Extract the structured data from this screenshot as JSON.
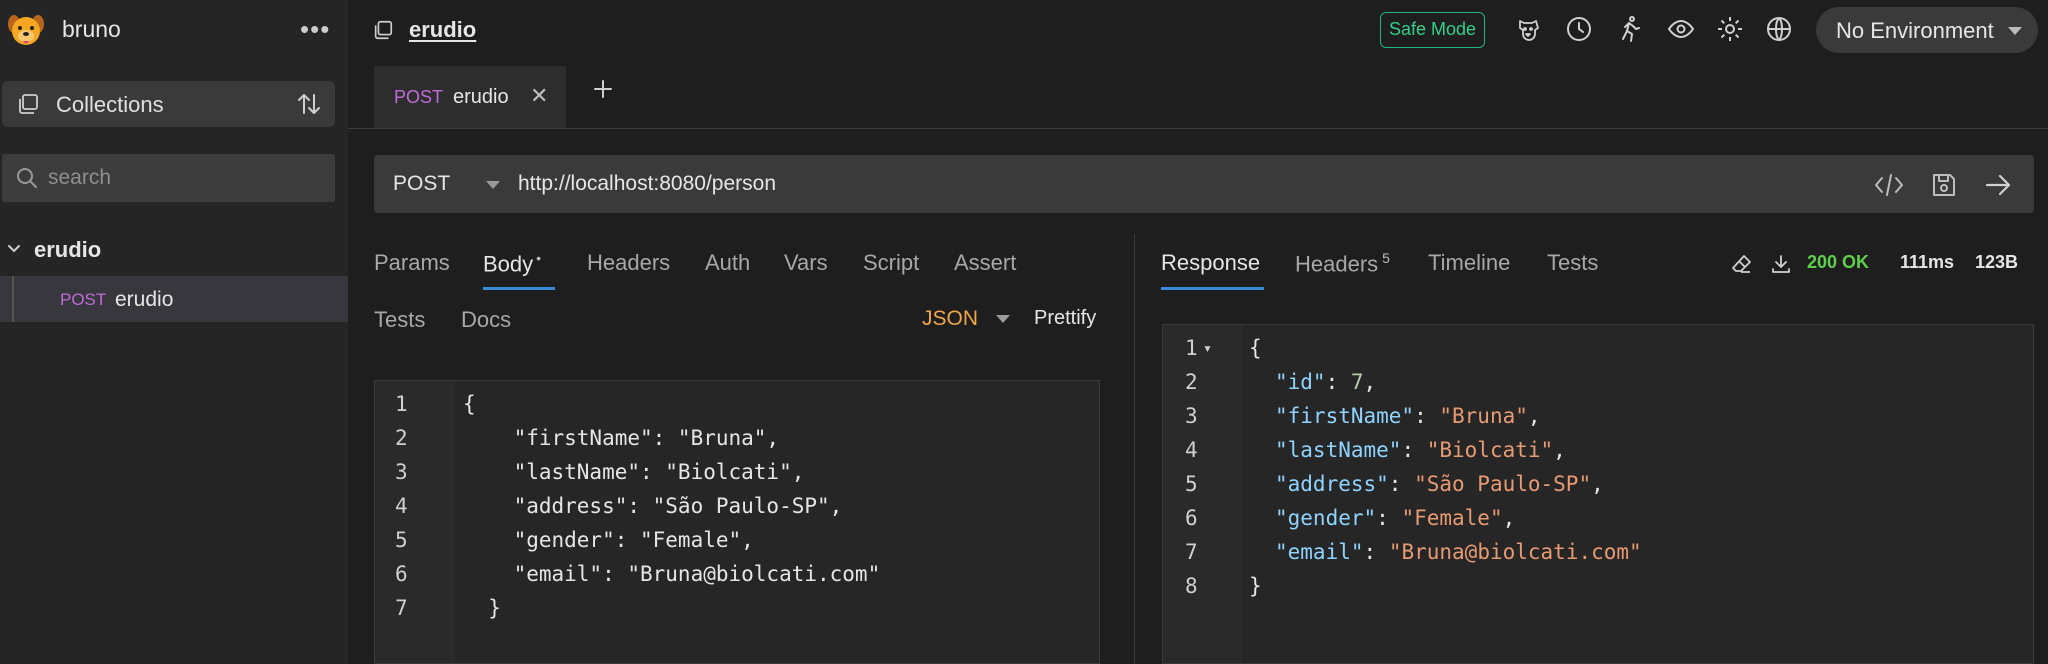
{
  "app": {
    "name": "bruno",
    "menu_glyph": "•••"
  },
  "sidebar": {
    "collections_label": "Collections",
    "search_placeholder": "search",
    "tree": {
      "collection_name": "erudio",
      "requests": [
        {
          "method": "POST",
          "name": "erudio"
        }
      ]
    }
  },
  "header": {
    "collection_title": "erudio",
    "safe_mode_label": "Safe Mode",
    "icons": [
      "bruno-dog-icon",
      "clock-icon",
      "runner-icon",
      "eye-icon",
      "gear-icon",
      "globe-icon"
    ],
    "environment": "No Environment"
  },
  "request_tab": {
    "method": "POST",
    "name": "erudio",
    "close_glyph": "✕"
  },
  "url_bar": {
    "method": "POST",
    "url": "http://localhost:8080/person"
  },
  "request_pane": {
    "tabs_row1": [
      "Params",
      "Body",
      "Headers",
      "Auth",
      "Vars",
      "Script",
      "Assert"
    ],
    "active_tab": "Body",
    "body_modified_marker": "•",
    "tabs_row2": [
      "Tests",
      "Docs"
    ],
    "body_mode": "JSON",
    "prettify_label": "Prettify",
    "line_numbers": [
      "1",
      "2",
      "3",
      "4",
      "5",
      "6",
      "7"
    ],
    "code_lines": [
      "{",
      "    \"firstName\": \"Bruna\",",
      "    \"lastName\": \"Biolcati\",",
      "    \"address\": \"São Paulo-SP\",",
      "    \"gender\": \"Female\",",
      "    \"email\": \"Bruna@biolcati.com\"",
      "  }"
    ]
  },
  "response_pane": {
    "tabs": [
      "Response",
      "Headers",
      "Timeline",
      "Tests"
    ],
    "active_tab": "Response",
    "headers_count": "5",
    "status": "200 OK",
    "time": "111ms",
    "size": "123B",
    "line_numbers": [
      "1",
      "2",
      "3",
      "4",
      "5",
      "6",
      "7",
      "8"
    ],
    "fold_glyph": "▾",
    "code": {
      "open": "{",
      "close": "}",
      "fields": [
        {
          "key": "\"id\"",
          "value": "7",
          "type": "number",
          "comma": ","
        },
        {
          "key": "\"firstName\"",
          "value": "\"Bruna\"",
          "type": "string",
          "comma": ","
        },
        {
          "key": "\"lastName\"",
          "value": "\"Biolcati\"",
          "type": "string",
          "comma": ","
        },
        {
          "key": "\"address\"",
          "value": "\"São Paulo-SP\"",
          "type": "string",
          "comma": ","
        },
        {
          "key": "\"gender\"",
          "value": "\"Female\"",
          "type": "string",
          "comma": ","
        },
        {
          "key": "\"email\"",
          "value": "\"Bruna@biolcati.com\"",
          "type": "string",
          "comma": ""
        }
      ]
    }
  },
  "colors": {
    "method_post": "#c06bd8",
    "safe_mode": "#2fd08a",
    "status_ok": "#5ecf4a",
    "json_mode": "#f0a64b",
    "active_tab_underline": "#3a8bdb"
  }
}
